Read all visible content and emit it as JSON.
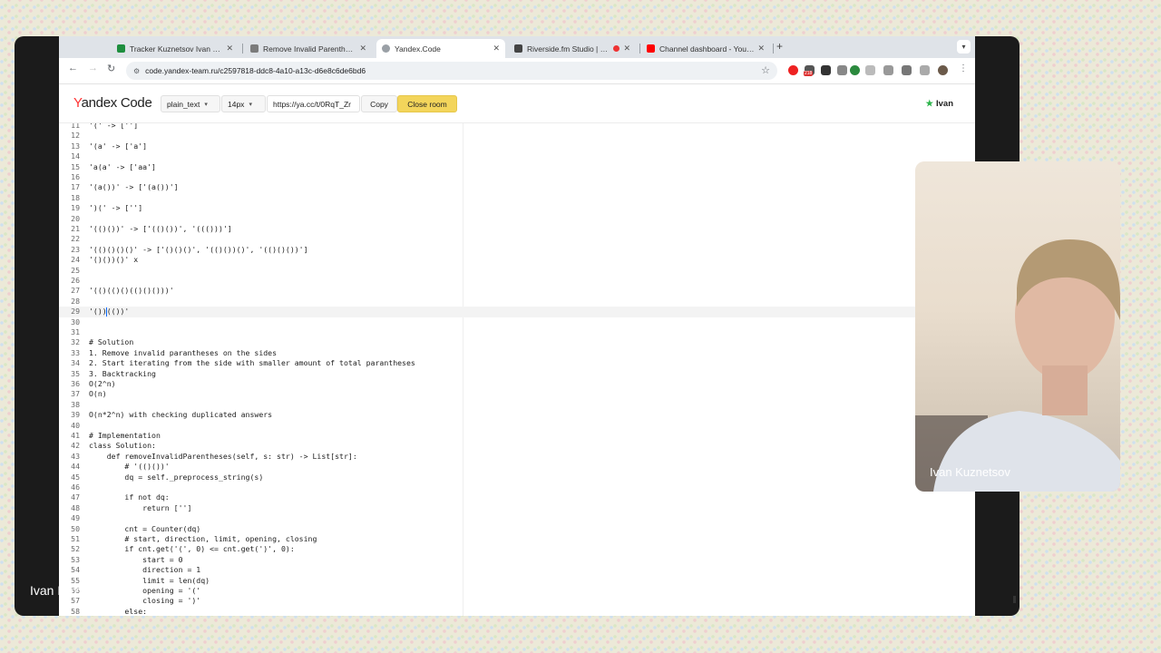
{
  "tabs": [
    {
      "title": "Tracker Kuznetsov Ivan - Goo",
      "favicon_color": "#1e8e3e",
      "active": false
    },
    {
      "title": "Remove Invalid Parentheses",
      "favicon_color": "#7b7b7b",
      "active": false
    },
    {
      "title": "Yandex.Code",
      "favicon_color": "#9aa0a6",
      "active": true
    },
    {
      "title": "Riverside.fm Studio | Ivan",
      "favicon_color": "#444444",
      "active": false
    },
    {
      "title": "Channel dashboard - YouTub",
      "favicon_color": "#ff0000",
      "active": false
    }
  ],
  "tab_close": "✕",
  "new_tab": "+",
  "address": {
    "url": "code.yandex-team.ru/c2597818-ddc8-4a10-a13c-d6e8c6de6bd6"
  },
  "extension_badge": "218",
  "header": {
    "logo_y": "Y",
    "logo_rest": "andex Code",
    "language": "plain_text",
    "font_size": "14px",
    "share_url": "https://ya.cc/t/0RqT_Zr",
    "copy_label": "Copy",
    "close_label": "Close room",
    "user": "Ivan"
  },
  "code_lines": [
    {
      "n": "11",
      "text": "'(' -> ['']"
    },
    {
      "n": "12",
      "text": ""
    },
    {
      "n": "13",
      "text": "'(a' -> ['a']"
    },
    {
      "n": "14",
      "text": ""
    },
    {
      "n": "15",
      "text": "'a(a' -> ['aa']"
    },
    {
      "n": "16",
      "text": ""
    },
    {
      "n": "17",
      "text": "'(a())' -> ['(a())']"
    },
    {
      "n": "18",
      "text": ""
    },
    {
      "n": "19",
      "text": "')(' -> ['']"
    },
    {
      "n": "20",
      "text": ""
    },
    {
      "n": "21",
      "text": "'(()())' -> ['(()())', '((()))']"
    },
    {
      "n": "22",
      "text": ""
    },
    {
      "n": "23",
      "text": "'(()()()()' -> ['()()()', '(()())()', '(()()())']"
    },
    {
      "n": "24",
      "text": "'()())()' x"
    },
    {
      "n": "25",
      "text": ""
    },
    {
      "n": "26",
      "text": ""
    },
    {
      "n": "27",
      "text": "'(()(()()(()()()))'"
    },
    {
      "n": "28",
      "text": ""
    },
    {
      "n": "29",
      "text": "'())(())'"
    },
    {
      "n": "30",
      "text": ""
    },
    {
      "n": "31",
      "text": ""
    },
    {
      "n": "32",
      "text": "# Solution"
    },
    {
      "n": "33",
      "text": "1. Remove invalid parantheses on the sides"
    },
    {
      "n": "34",
      "text": "2. Start iterating from the side with smaller amount of total parantheses"
    },
    {
      "n": "35",
      "text": "3. Backtracking"
    },
    {
      "n": "36",
      "text": "O(2^n)"
    },
    {
      "n": "37",
      "text": "O(n)"
    },
    {
      "n": "38",
      "text": ""
    },
    {
      "n": "39",
      "text": "O(n*2^n) with checking duplicated answers"
    },
    {
      "n": "40",
      "text": ""
    },
    {
      "n": "41",
      "text": "# Implementation"
    },
    {
      "n": "42",
      "text": "class Solution:"
    },
    {
      "n": "43",
      "text": "    def removeInvalidParentheses(self, s: str) -> List[str]:"
    },
    {
      "n": "44",
      "text": "        # '(()())'"
    },
    {
      "n": "45",
      "text": "        dq = self._preprocess_string(s)"
    },
    {
      "n": "46",
      "text": ""
    },
    {
      "n": "47",
      "text": "        if not dq:"
    },
    {
      "n": "48",
      "text": "            return ['']"
    },
    {
      "n": "49",
      "text": ""
    },
    {
      "n": "50",
      "text": "        cnt = Counter(dq)"
    },
    {
      "n": "51",
      "text": "        # start, direction, limit, opening, closing"
    },
    {
      "n": "52",
      "text": "        if cnt.get('(', 0) <= cnt.get(')', 0):"
    },
    {
      "n": "53",
      "text": "            start = 0"
    },
    {
      "n": "54",
      "text": "            direction = 1"
    },
    {
      "n": "55",
      "text": "            limit = len(dq)"
    },
    {
      "n": "56",
      "text": "            opening = '('"
    },
    {
      "n": "57",
      "text": "            closing = ')'"
    },
    {
      "n": "58",
      "text": "        else:"
    }
  ],
  "highlighted_line": "29",
  "webcam": {
    "name": "Ivan Kuznetsov"
  },
  "overlay_name": "Ivan Kuznetsov"
}
